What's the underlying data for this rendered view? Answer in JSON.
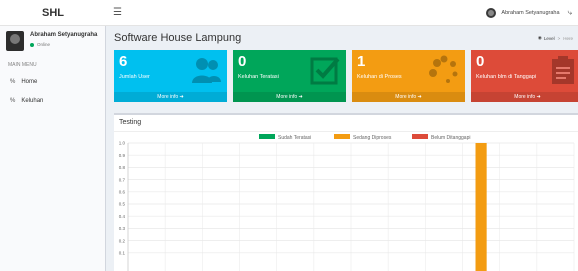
{
  "brand": {
    "logo": "SHL"
  },
  "topbar": {
    "menu_icon": "hamburger-icon",
    "user_name": "Abraham Setyanugraha",
    "share_icon": "share-icon"
  },
  "sidebar": {
    "user_name": "Abraham Setyanugraha",
    "status": "Online",
    "menu_header": "MAIN MENU",
    "items": [
      {
        "label": "Home",
        "icon": "link-icon"
      },
      {
        "label": "Keluhan",
        "icon": "link-icon"
      }
    ]
  },
  "page": {
    "title": "Software House Lampung",
    "breadcrumb": [
      {
        "label": "Level",
        "icon": "dashboard-icon"
      },
      {
        "label": "Here"
      }
    ]
  },
  "stat_boxes": [
    {
      "value": "6",
      "label": "Jumlah User",
      "footer": "More info",
      "color": "#00c0ef",
      "icon": "users-icon"
    },
    {
      "value": "0",
      "label": "Keluhan Teratasi",
      "footer": "More info",
      "color": "#00a65a",
      "icon": "check-square-icon"
    },
    {
      "value": "1",
      "label": "Keluhan di Proses",
      "footer": "More info",
      "color": "#f39c12",
      "icon": "spinner-icon"
    },
    {
      "value": "0",
      "label": "Keluhan blm di Tanggapi",
      "footer": "More info",
      "color": "#dd4b39",
      "icon": "clipboard-icon"
    }
  ],
  "chart_box": {
    "title": "Testing"
  },
  "chart_data": {
    "type": "bar",
    "title": "",
    "categories": [
      "",
      "",
      "",
      "",
      "",
      "",
      "",
      "",
      "",
      "",
      "",
      ""
    ],
    "series": [
      {
        "name": "Sudah Teratasi",
        "color": "#00a65a",
        "values": [
          0,
          0,
          0,
          0,
          0,
          0,
          0,
          0,
          0,
          0,
          0,
          0
        ]
      },
      {
        "name": "Sedang Diproses",
        "color": "#f39c12",
        "values": [
          0,
          0,
          0,
          0,
          0,
          0,
          0,
          0,
          0,
          1,
          0,
          0
        ]
      },
      {
        "name": "Belum Ditanggapi",
        "color": "#dd4b39",
        "values": [
          0,
          0,
          0,
          0,
          0,
          0,
          0,
          0,
          0,
          0,
          0,
          0
        ]
      }
    ],
    "yticks": [
      "1.0",
      "0.9",
      "0.8",
      "0.7",
      "0.6",
      "0.5",
      "0.4",
      "0.3",
      "0.2",
      "0.1"
    ],
    "ylim": [
      0,
      1
    ],
    "grid": true,
    "legend": "top"
  }
}
